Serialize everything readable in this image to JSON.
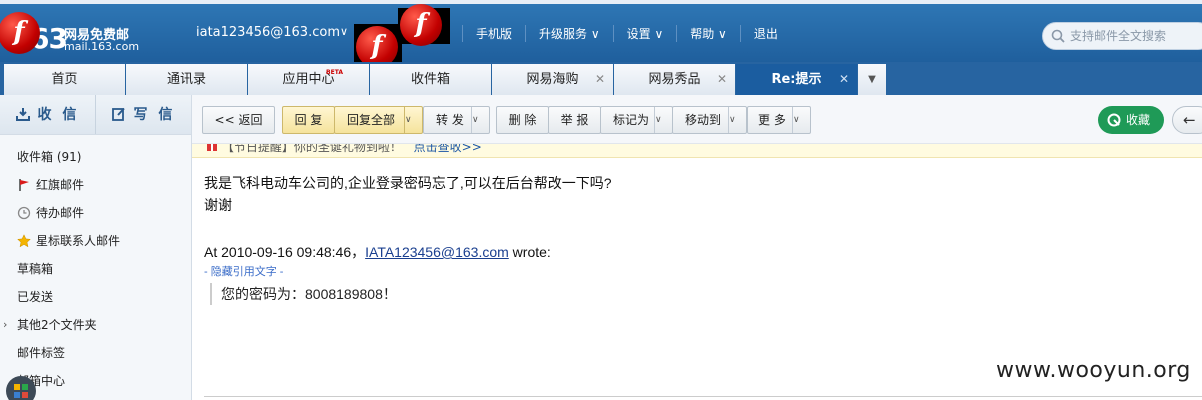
{
  "header": {
    "logo_num": "63",
    "logo_title": "网易免费邮",
    "logo_domain": "mail.163.com",
    "user_email": "iata123456@163.com",
    "user_caret": "∨",
    "nav": [
      "手机版",
      "升级服务 ∨",
      "设置 ∨",
      "帮助 ∨",
      "退出"
    ],
    "search_placeholder": "支持邮件全文搜索",
    "accent": "#1f5f9d"
  },
  "tabs": [
    {
      "label": "首页",
      "close": "",
      "beta": ""
    },
    {
      "label": "通讯录",
      "close": "",
      "beta": ""
    },
    {
      "label": "应用中心",
      "close": "",
      "beta": "BETA"
    },
    {
      "label": "收件箱",
      "close": "",
      "beta": ""
    },
    {
      "label": "网易海购",
      "close": "✕",
      "beta": ""
    },
    {
      "label": "网易秀品",
      "close": "✕",
      "beta": ""
    },
    {
      "label": "Re:提示",
      "close": "✕",
      "beta": "",
      "active": true
    }
  ],
  "sidebar": {
    "receive": "收 信",
    "write": "写 信",
    "folders": [
      {
        "label": "收件箱 (91)",
        "icon": ""
      },
      {
        "label": "红旗邮件",
        "icon": "red-flag-icon"
      },
      {
        "label": "待办邮件",
        "icon": "clock-icon"
      },
      {
        "label": "星标联系人邮件",
        "icon": "star-icon"
      },
      {
        "label": "草稿箱",
        "icon": ""
      },
      {
        "label": "已发送",
        "icon": ""
      },
      {
        "label": "其他2个文件夹",
        "icon": "chevron-right-icon"
      },
      {
        "label": "邮件标签",
        "icon": ""
      },
      {
        "label": "邮箱中心",
        "icon": ""
      }
    ]
  },
  "toolbar": {
    "back": "<< 返回",
    "reply": "回 复",
    "reply_all": "回复全部",
    "forward": "转 发",
    "delete": "删 除",
    "report": "举 报",
    "mark_as": "标记为",
    "move_to": "移动到",
    "more": "更 多",
    "favorite": "收藏",
    "back_arrow": "←"
  },
  "notice": {
    "text": "【节日提醒】你的圣诞礼物到啦！",
    "link": "点击查收>>"
  },
  "mail": {
    "line1": "我是飞科电动车公司的,企业登录密码忘了,可以在后台帮改一下吗?",
    "line2": "谢谢",
    "wrote_prefix": "At 2010-09-16 09:48:46，",
    "wrote_email": "IATA123456@163.com",
    "wrote_suffix": " wrote:",
    "hide_quote": "- 隐藏引用文字 -",
    "quote": "您的密码为：8008189808！"
  },
  "watermark": "www.wooyun.org"
}
